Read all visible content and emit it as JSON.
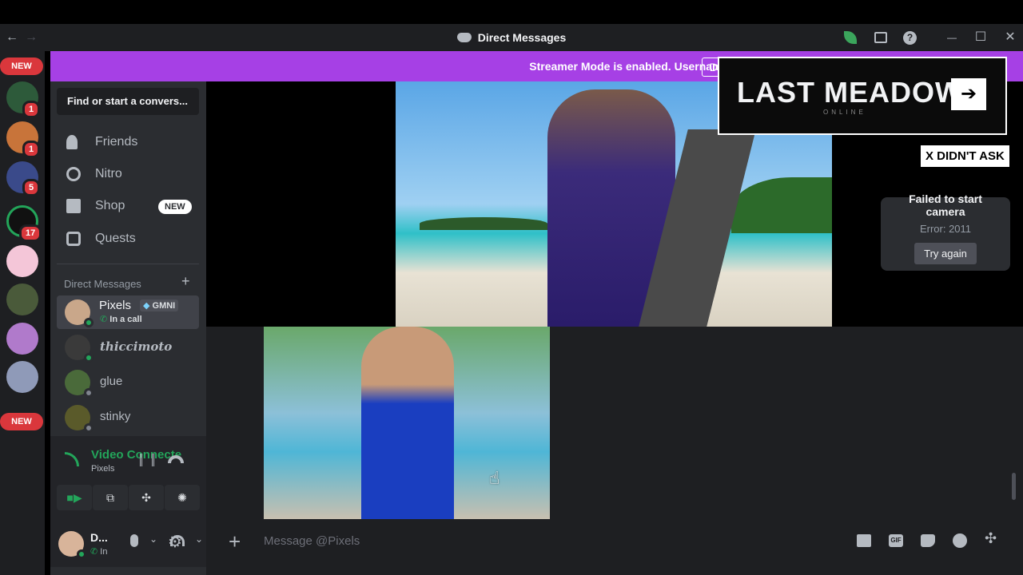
{
  "window": {
    "title": "Direct Messages",
    "nav_back": "←",
    "nav_forward": "→",
    "minimize": "—",
    "maximize": "☐",
    "close": "✕"
  },
  "server_rail": {
    "top_badge": "NEW",
    "bottom_badge": "NEW",
    "badges": [
      "1",
      "1",
      "5",
      "17"
    ]
  },
  "banner": {
    "text": "Streamer Mode is enabled. Usernames have been truncated.",
    "button": "Disable"
  },
  "sidebar": {
    "search_placeholder": "Find or start a convers...",
    "nav": [
      {
        "label": "Friends"
      },
      {
        "label": "Nitro"
      },
      {
        "label": "Shop",
        "badge": "NEW"
      },
      {
        "label": "Quests"
      }
    ],
    "dm_header": "Direct Messages",
    "dm_add": "+",
    "dms": [
      {
        "name": "Pixels",
        "tag": "GMNI",
        "status_text": "In a call"
      },
      {
        "name": "thiccimoto"
      },
      {
        "name": "glue"
      },
      {
        "name": "stinky"
      }
    ]
  },
  "voice_panel": {
    "title": "Video Connecte",
    "subtitle": "Pixels"
  },
  "user_panel": {
    "name": "D...",
    "status": "In"
  },
  "call": {
    "error_title_line1": "Failed to start",
    "error_title_line2": "camera",
    "error_code": "Error: 2011",
    "retry": "Try again"
  },
  "overlay": {
    "ad_text": "LAST MEADOW",
    "ad_sub": "ONLINE",
    "ad_arrow": "➔",
    "dismiss": "X DIDN'T ASK"
  },
  "composer": {
    "add": "+",
    "placeholder": "Message @Pixels"
  },
  "colors": {
    "banner": "#a640e5",
    "online": "#23a55a",
    "badge": "#da373c"
  }
}
